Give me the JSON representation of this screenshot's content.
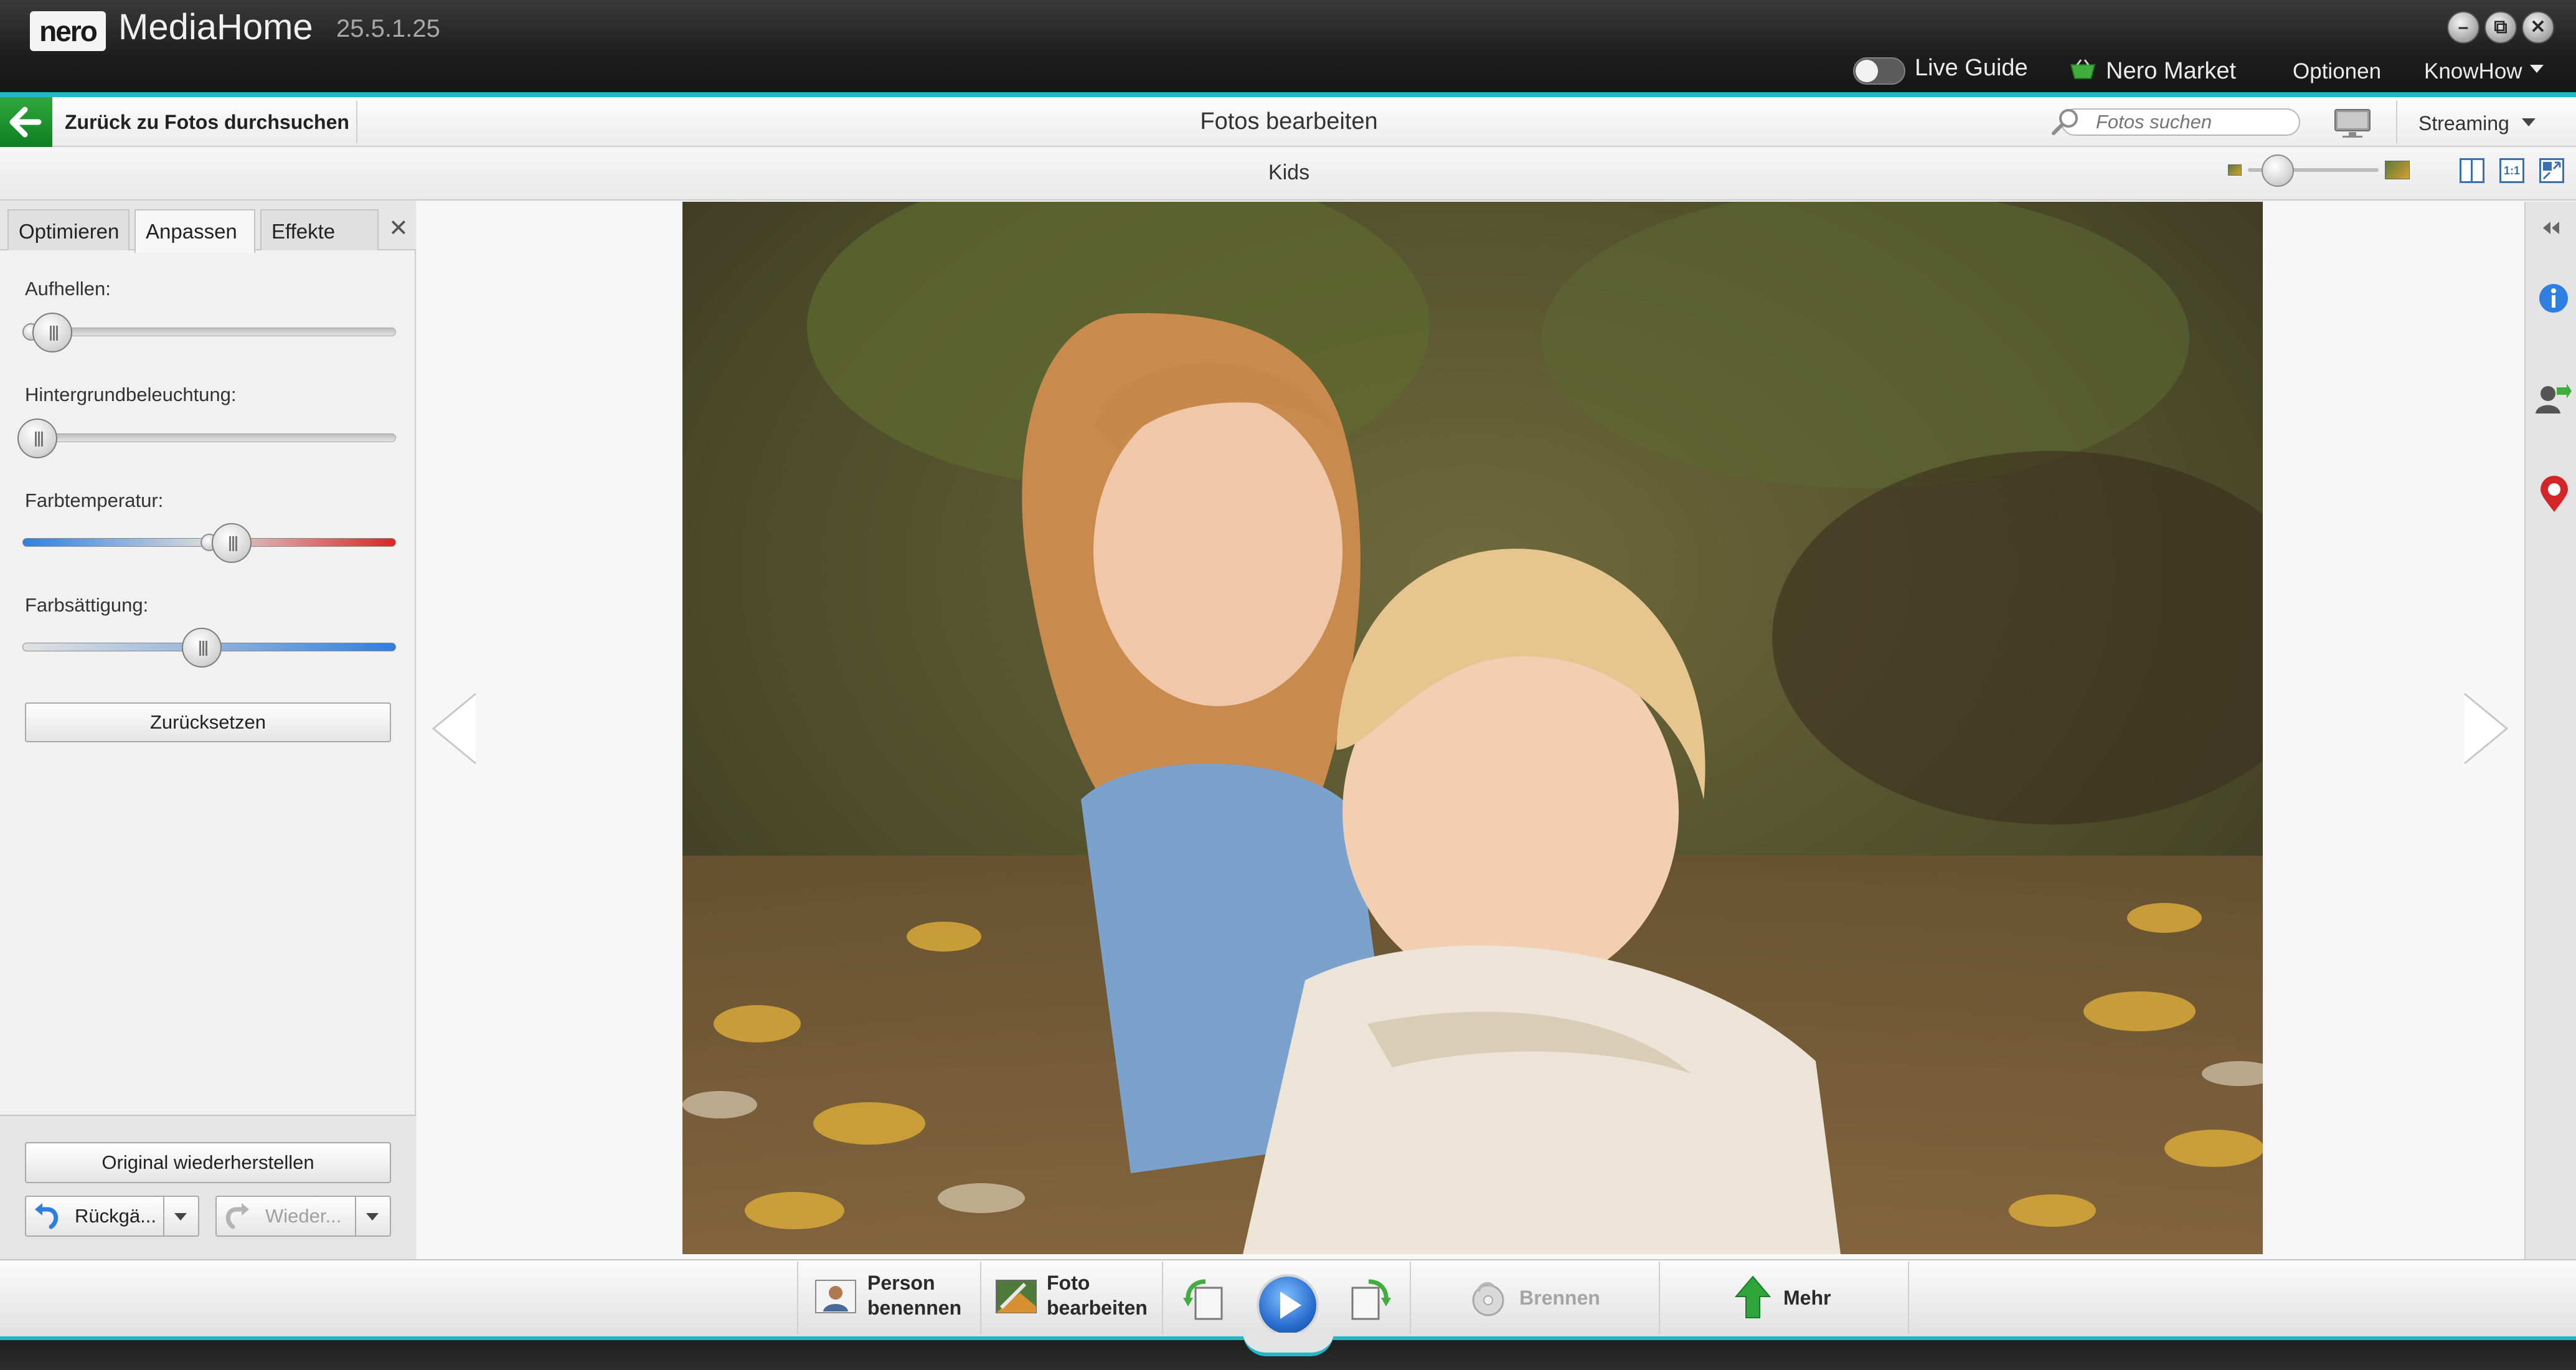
{
  "window": {
    "logo_text": "nero",
    "app_name": "MediaHome",
    "version": "25.5.1.25",
    "controls": {
      "minimize": "–",
      "maximize": "⧉",
      "close": "✕"
    }
  },
  "topmenu": {
    "live_guide": "Live Guide",
    "nero_market": "Nero Market",
    "options": "Optionen",
    "knowhow": "KnowHow"
  },
  "toolbar": {
    "back_label": "Zurück zu Fotos durchsuchen",
    "title": "Fotos bearbeiten",
    "search_placeholder": "Fotos suchen",
    "streaming": "Streaming"
  },
  "album": {
    "title": "Kids"
  },
  "view": {
    "actual_size": "1:1"
  },
  "panel": {
    "tabs": [
      {
        "label": "Optimieren"
      },
      {
        "label": "Anpassen",
        "active": true
      },
      {
        "label": "Effekte"
      }
    ],
    "close": "✕",
    "sliders": [
      {
        "label": "Aufhellen:",
        "level": 0.08
      },
      {
        "label": "Hintergrundbeleuchtung:",
        "level": 0.04
      },
      {
        "label": "Farbtemperatur:",
        "level": 0.56
      },
      {
        "label": "Farbsättigung:",
        "level": 0.48
      }
    ],
    "reset_button": "Zurücksetzen",
    "restore_button": "Original wiederherstellen",
    "undo_button": "Rückgä...",
    "redo_button": "Wieder..."
  },
  "bottombar": {
    "person_line1": "Person",
    "person_line2": "benennen",
    "edit_line1": "Foto",
    "edit_line2": "bearbeiten",
    "burn": "Brennen",
    "more": "Mehr"
  },
  "colors": {
    "accent": "#20b9c9",
    "back_green": "#1a8f2d",
    "link_blue": "#2f7fe0"
  },
  "icons": [
    "basket-icon",
    "search-icon",
    "monitor-icon",
    "info-icon",
    "person-tag-icon",
    "map-pin-icon",
    "rotate-left-icon",
    "rotate-right-icon",
    "play-icon",
    "burn-disc-icon",
    "up-arrow-icon"
  ]
}
